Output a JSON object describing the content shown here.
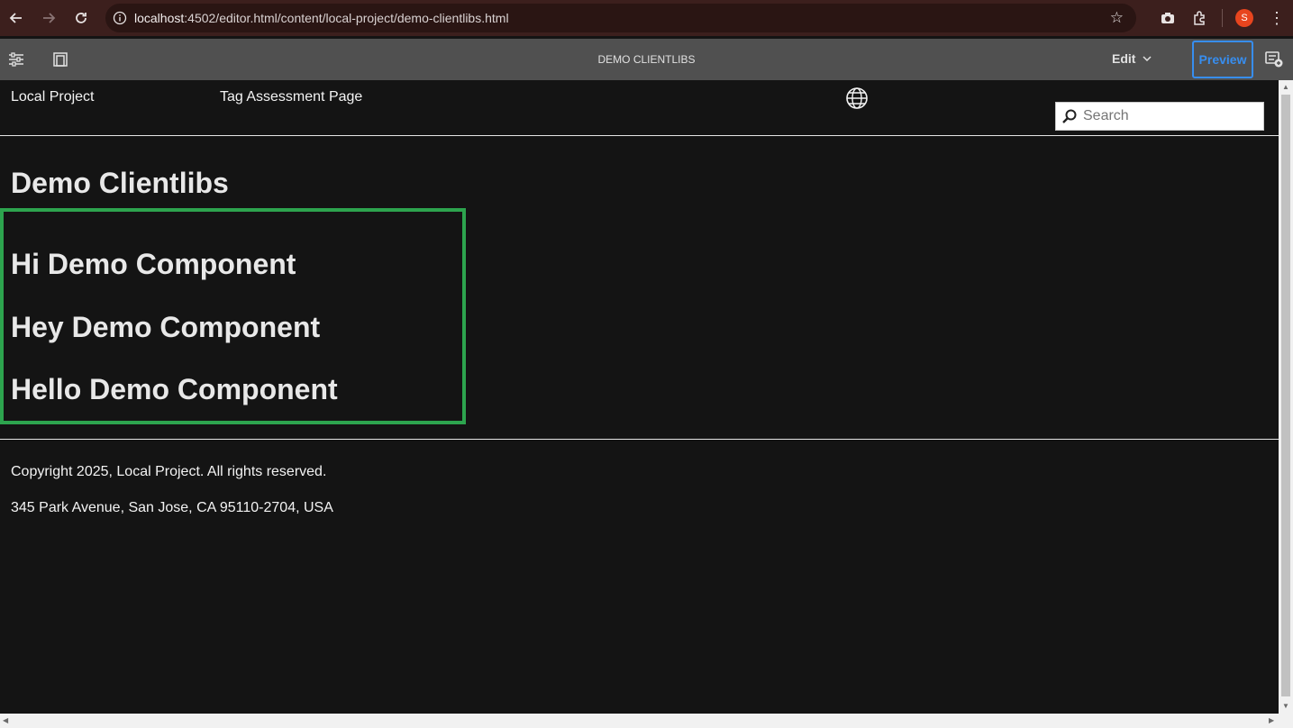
{
  "browser": {
    "url_host": "localhost",
    "url_rest": ":4502/editor.html/content/local-project/demo-clientlibs.html",
    "profile_initial": "S"
  },
  "editor": {
    "page_title": "DEMO CLIENTLIBS",
    "mode_label": "Edit",
    "preview_label": "Preview"
  },
  "site": {
    "brand": "Local Project",
    "nav_link": "Tag Assessment Page",
    "search_placeholder": "Search"
  },
  "main": {
    "title": "Demo Clientlibs",
    "component_lines": [
      "Hi Demo Component",
      "Hey Demo Component",
      "Hello Demo Component"
    ],
    "component_border_color": "#2da44e"
  },
  "footer": {
    "copyright": "Copyright 2025, Local Project. All rights reserved.",
    "address": "345 Park Avenue, San Jose, CA 95110-2704, USA"
  },
  "colors": {
    "browser_bar": "#3c1f1d",
    "editor_bar": "#505050",
    "accent": "#378ef0",
    "page_bg": "#141414"
  }
}
